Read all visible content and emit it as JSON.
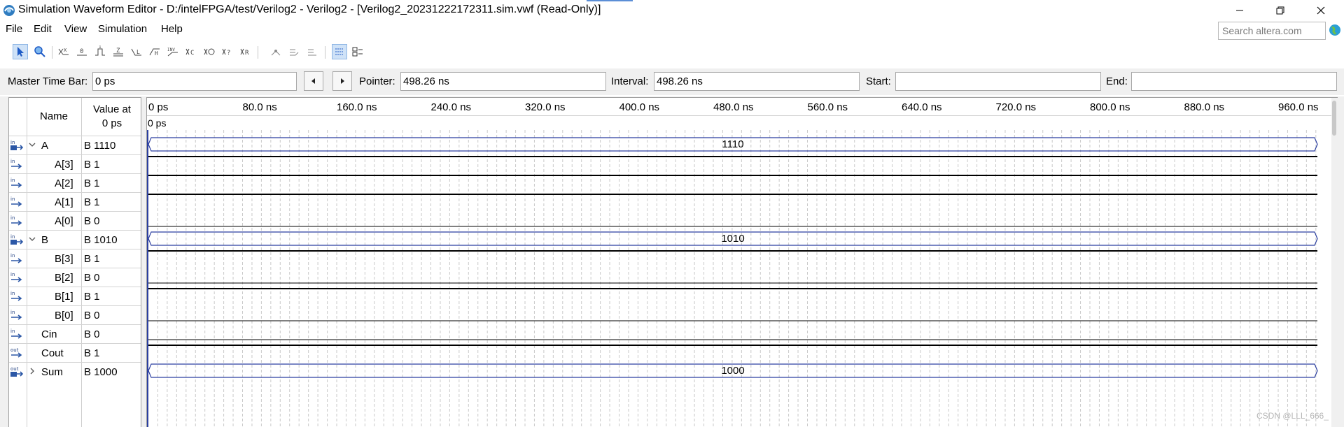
{
  "window": {
    "title": "Simulation Waveform Editor - D:/intelFPGA/test/Verilog2 - Verilog2 - [Verilog2_20231222172311.sim.vwf (Read-Only)]"
  },
  "menu": {
    "items": [
      "File",
      "Edit",
      "View",
      "Simulation",
      "Help"
    ],
    "search_placeholder": "Search altera.com"
  },
  "toolbar": {
    "tools": [
      {
        "icon": "selection-arrow-icon",
        "active": true
      },
      {
        "icon": "zoom-icon",
        "active": false
      },
      {
        "icon": "forcing-unknown-icon",
        "text": "X"
      },
      {
        "icon": "forcing-low-icon",
        "text": "0"
      },
      {
        "icon": "forcing-high-icon",
        "text": "1"
      },
      {
        "icon": "high-impedance-icon",
        "text": "Z"
      },
      {
        "icon": "weak-low-icon",
        "text": "L"
      },
      {
        "icon": "weak-high-icon",
        "text": "H"
      },
      {
        "icon": "invert-icon",
        "text": "INV"
      },
      {
        "icon": "count-value-icon",
        "text": "C"
      },
      {
        "icon": "clock-icon",
        "text": "CLK"
      },
      {
        "icon": "arbitrary-value-icon",
        "text": "?"
      },
      {
        "icon": "random-value-icon",
        "text": "R"
      },
      {
        "icon": "snap-to-grid-icon"
      },
      {
        "icon": "group-icon"
      },
      {
        "icon": "ungroup-icon"
      },
      {
        "icon": "grid-toggle-icon",
        "active": true
      },
      {
        "icon": "node-finder-icon"
      }
    ]
  },
  "timebar": {
    "master_label": "Master Time Bar:",
    "master_value": "0 ps",
    "pointer_label": "Pointer:",
    "pointer_value": "498.26 ns",
    "interval_label": "Interval:",
    "interval_value": "498.26 ns",
    "start_label": "Start:",
    "start_value": "",
    "end_label": "End:",
    "end_value": ""
  },
  "grid": {
    "name_header": "Name",
    "value_header_line1": "Value at",
    "value_header_line2": "0 ps",
    "cursor_label": "0 ps",
    "ruler_ticks": [
      {
        "label": "0 ps",
        "ns": 0
      },
      {
        "label": "80.0 ns",
        "ns": 80
      },
      {
        "label": "160.0 ns",
        "ns": 160
      },
      {
        "label": "240.0 ns",
        "ns": 240
      },
      {
        "label": "320.0 ns",
        "ns": 320
      },
      {
        "label": "400.0 ns",
        "ns": 400
      },
      {
        "label": "480.0 ns",
        "ns": 480
      },
      {
        "label": "560.0 ns",
        "ns": 560
      },
      {
        "label": "640.0 ns",
        "ns": 640
      },
      {
        "label": "720.0 ns",
        "ns": 720
      },
      {
        "label": "800.0 ns",
        "ns": 800
      },
      {
        "label": "880.0 ns",
        "ns": 880
      },
      {
        "label": "960.0 ns",
        "ns": 960
      }
    ]
  },
  "signals": [
    {
      "dir": "in",
      "name": "A",
      "value": "B 1110",
      "type": "bus",
      "expanded": true,
      "level": 0,
      "bus_text": "1110"
    },
    {
      "dir": "in",
      "name": "A[3]",
      "value": "B 1",
      "type": "bit",
      "bit": 1,
      "level": 1
    },
    {
      "dir": "in",
      "name": "A[2]",
      "value": "B 1",
      "type": "bit",
      "bit": 1,
      "level": 1
    },
    {
      "dir": "in",
      "name": "A[1]",
      "value": "B 1",
      "type": "bit",
      "bit": 1,
      "level": 1
    },
    {
      "dir": "in",
      "name": "A[0]",
      "value": "B 0",
      "type": "bit",
      "bit": 0,
      "level": 1
    },
    {
      "dir": "in",
      "name": "B",
      "value": "B 1010",
      "type": "bus",
      "expanded": true,
      "level": 0,
      "bus_text": "1010"
    },
    {
      "dir": "in",
      "name": "B[3]",
      "value": "B 1",
      "type": "bit",
      "bit": 1,
      "level": 1
    },
    {
      "dir": "in",
      "name": "B[2]",
      "value": "B 0",
      "type": "bit",
      "bit": 0,
      "level": 1
    },
    {
      "dir": "in",
      "name": "B[1]",
      "value": "B 1",
      "type": "bit",
      "bit": 1,
      "level": 1
    },
    {
      "dir": "in",
      "name": "B[0]",
      "value": "B 0",
      "type": "bit",
      "bit": 0,
      "level": 1
    },
    {
      "dir": "in",
      "name": "Cin",
      "value": "B 0",
      "type": "bit",
      "bit": 0,
      "level": 0
    },
    {
      "dir": "out",
      "name": "Cout",
      "value": "B 1",
      "type": "bit",
      "bit": 1,
      "level": 0
    },
    {
      "dir": "out",
      "name": "Sum",
      "value": "B 1000",
      "type": "bus",
      "expanded": false,
      "level": 0,
      "bus_text": "1000"
    }
  ],
  "watermark": "CSDN @LLL_666_",
  "colors": {
    "accent": "#1f5bc6",
    "bus_line": "#2b3fa0",
    "in_arrow": "#2b57a6",
    "out_arrow": "#2b57a6",
    "grid_dash": "#c9c9c9"
  }
}
